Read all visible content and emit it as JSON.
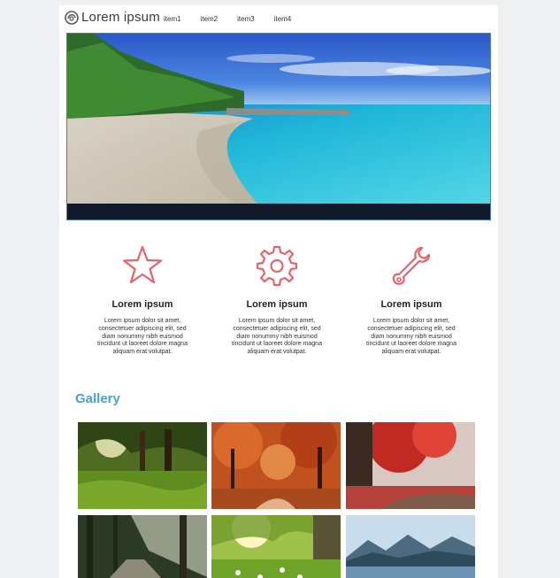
{
  "brand": {
    "name": "Lorem ipsum"
  },
  "nav": {
    "items": [
      "item1",
      "item2",
      "item3",
      "item4"
    ]
  },
  "features": [
    {
      "icon": "star-icon",
      "title": "Lorem ipsum",
      "text": "Lorem ipsum dolor sit amet, consectetuer adipiscing elit, sed diam nonummy nibh euismod tincidunt ut laoreet dolore magna aliquam erat volutpat."
    },
    {
      "icon": "gear-icon",
      "title": "Lorem ipsum",
      "text": "Lorem ipsum dolor sit amet, consectetuer adipiscing elit, sed diam nonummy nibh euismod tincidunt ut laoreet dolore magna aliquam erat volutpat."
    },
    {
      "icon": "wrench-icon",
      "title": "Lorem ipsum",
      "text": "Lorem ipsum dolor sit amet, consectetuer adipiscing elit, sed diam nonummy nibh euismod tincidunt ut laoreet dolore magna aliquam erat volutpat."
    }
  ],
  "gallery": {
    "title": "Gallery"
  },
  "colors": {
    "accent": "#e8616c",
    "gallery_title": "#4aa0d8",
    "page_bg": "#eef0f2"
  }
}
